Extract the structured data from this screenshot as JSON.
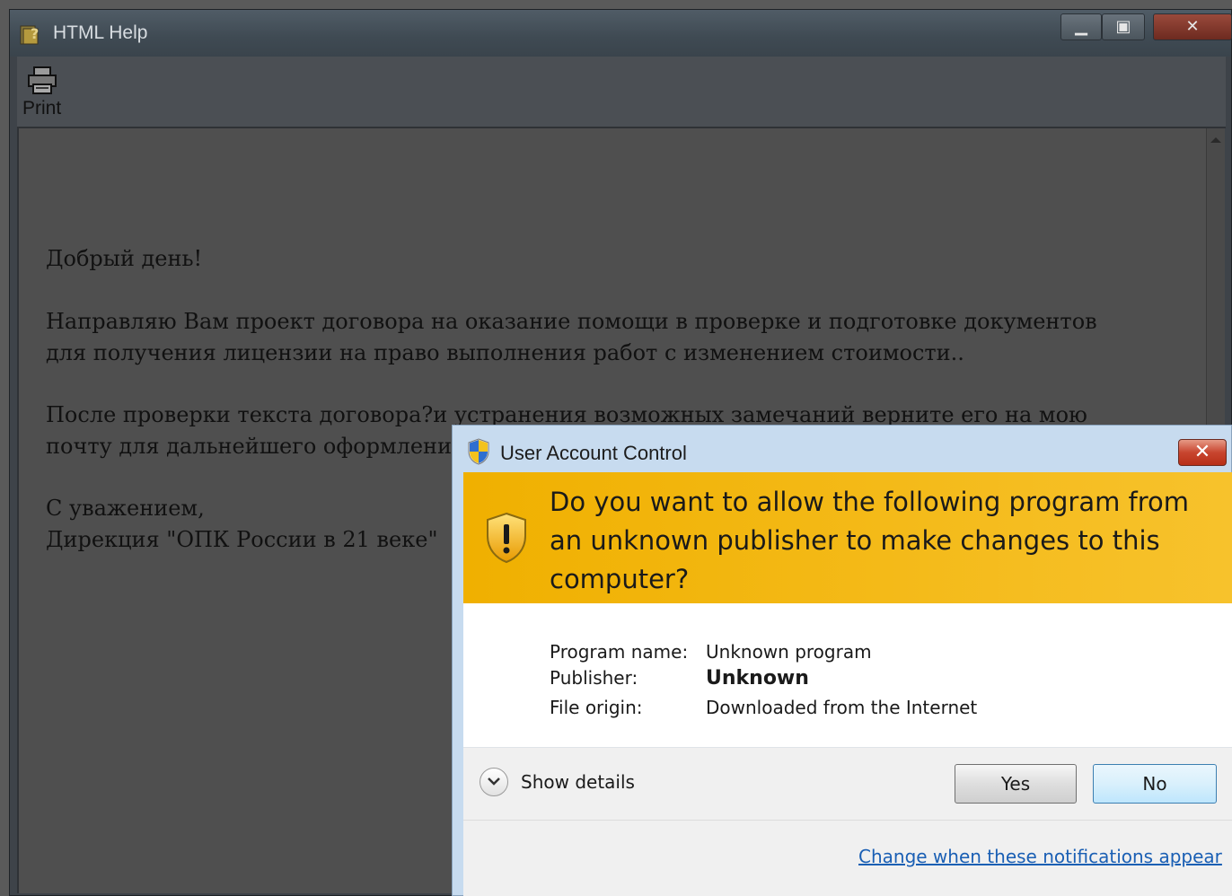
{
  "help_window": {
    "title": "HTML Help",
    "toolbar": {
      "print_label": "Print"
    },
    "content": {
      "greeting": "Добрый день!",
      "paragraph1_line1": "Направляю Вам проект договора на оказание помощи в проверке и подготовке документов",
      "paragraph1_line2": "для получения лицензии на право выполнения работ с изменением стоимости..",
      "paragraph2_line1": "После проверки текста договора?и устранения возможных замечаний верните его на мою",
      "paragraph2_line2": "почту для дальнейшего оформлени",
      "closing": "С уважением,",
      "signature": "Дирекция \"ОПК России в 21 веке\""
    }
  },
  "uac_dialog": {
    "title": "User Account Control",
    "question": "Do you want to allow the following program from an unknown publisher to make changes to this computer?",
    "fields": [
      {
        "label": "Program name:",
        "value": "Unknown program"
      },
      {
        "label": "Publisher:",
        "value": "Unknown"
      },
      {
        "label": "File origin:",
        "value": "Downloaded from the Internet"
      }
    ],
    "show_details_label": "Show details",
    "yes_label": "Yes",
    "no_label": "No",
    "settings_link": "Change when these notifications appear",
    "banner_color": "#f0b000",
    "link_color": "#1a5fb4"
  }
}
